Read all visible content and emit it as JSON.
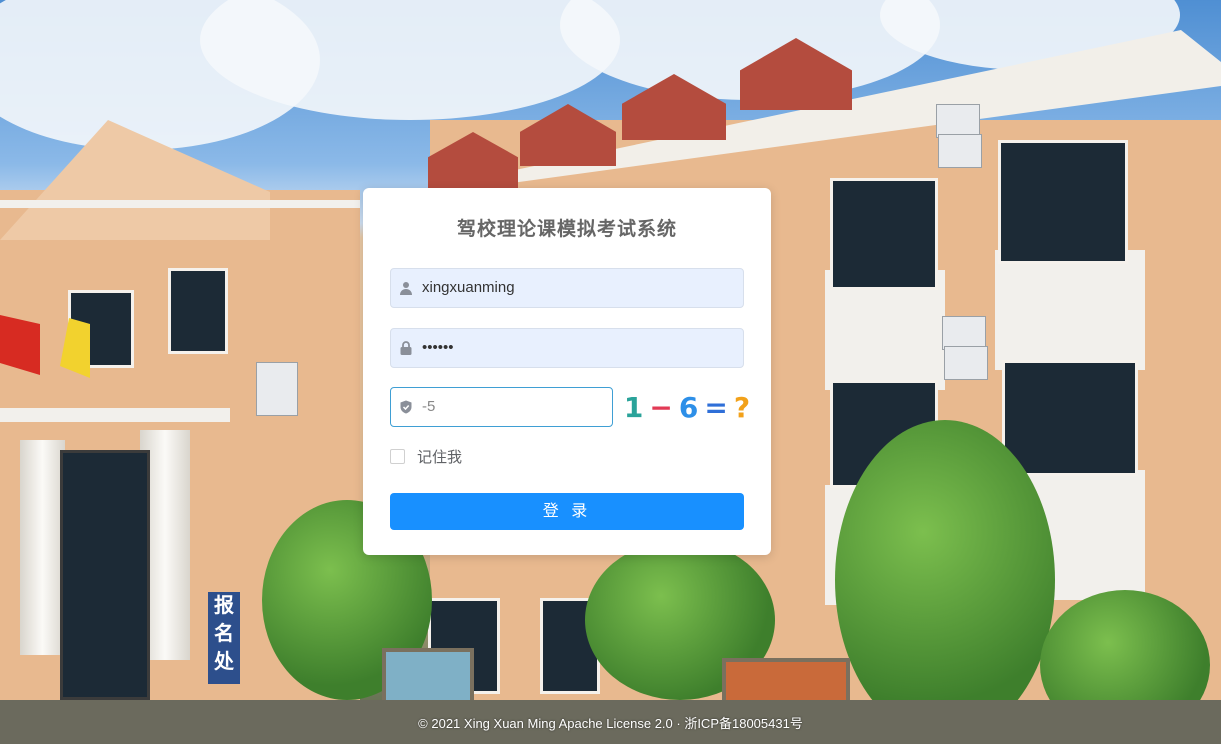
{
  "login": {
    "title": "驾校理论课模拟考试系统",
    "username_value": "xingxuanming",
    "password_value": "••••••",
    "captcha_value": "-5",
    "captcha_image": {
      "d1": "1",
      "op": "−",
      "d2": "6",
      "eq": "=",
      "q": "?"
    },
    "remember_label": "记住我",
    "login_button": "登 录"
  },
  "background_sign": "报名处",
  "footer": {
    "text": "© 2021 Xing Xuan Ming Apache License 2.0 · 浙ICP备18005431号"
  },
  "colors": {
    "primary": "#1890ff",
    "input_bg": "#e8f0fe",
    "captcha_border": "#3f9fd4"
  }
}
